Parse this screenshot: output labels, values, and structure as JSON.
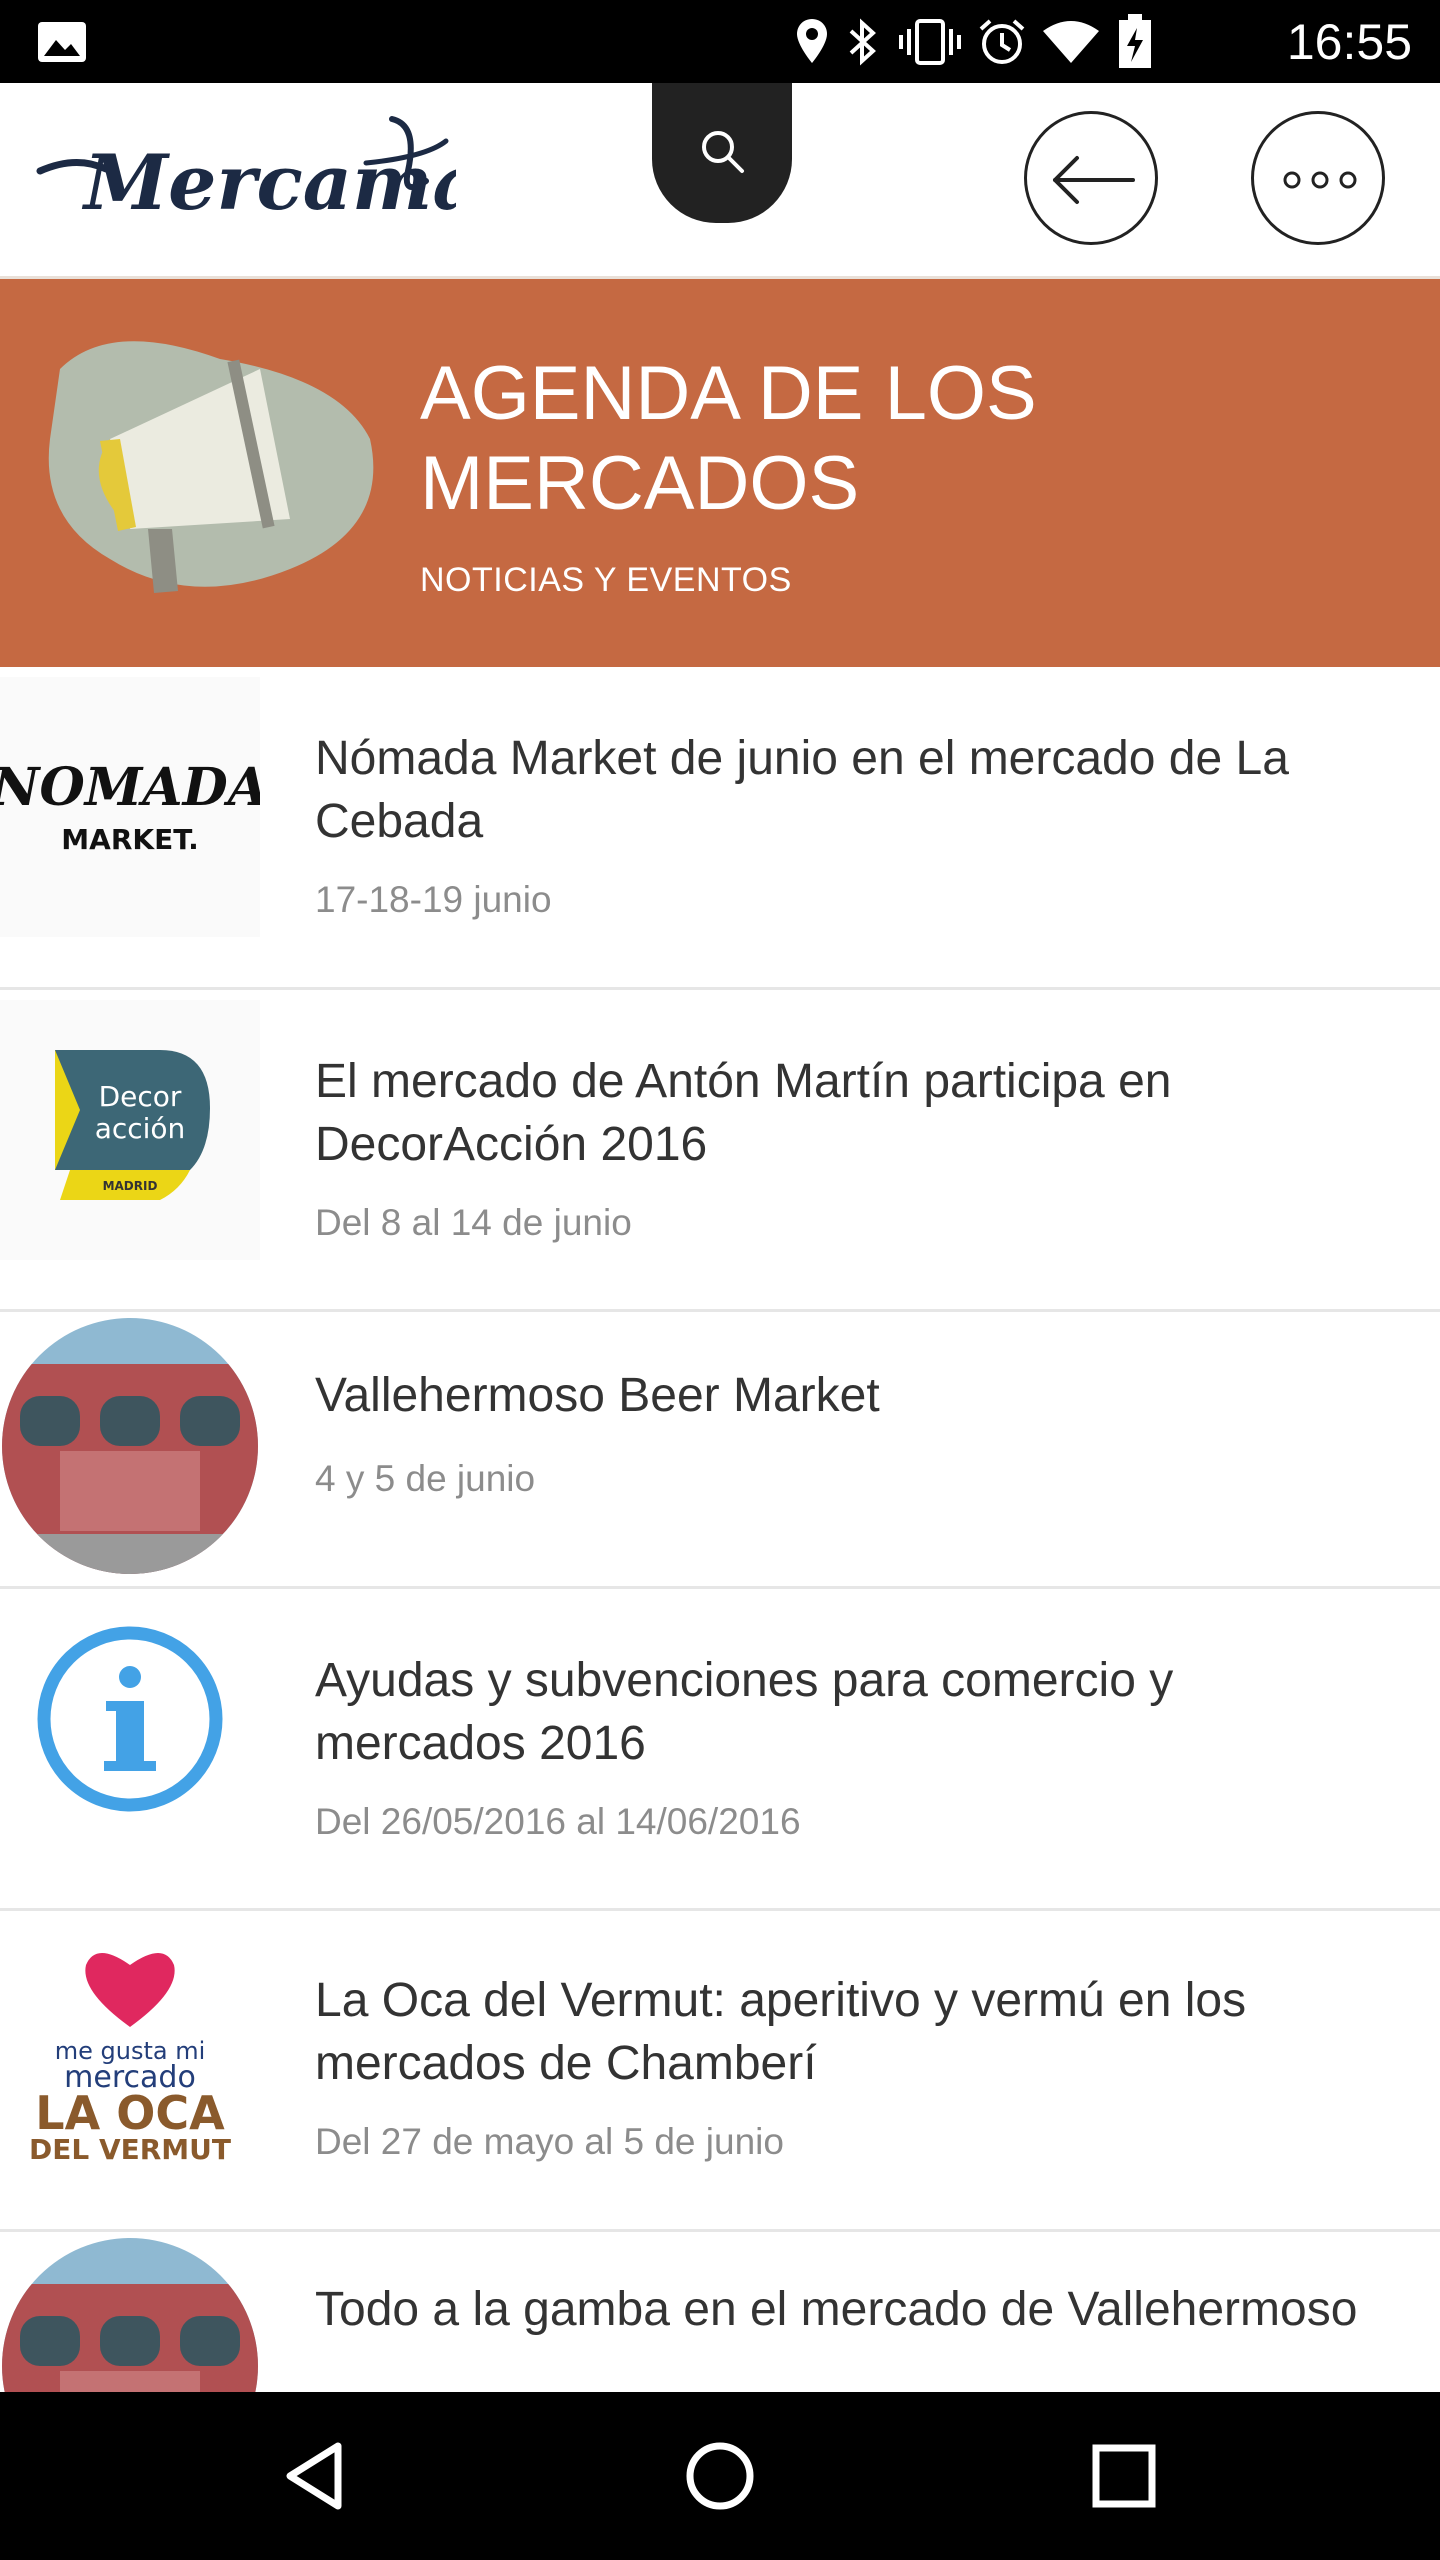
{
  "status_bar": {
    "time": "16:55"
  },
  "header": {
    "logo_text": "Mercamad",
    "search_icon": "search-icon",
    "back_icon": "arrow-left-icon",
    "more_icon": "more-dots-icon"
  },
  "banner": {
    "title": "AGENDA DE LOS MERCADOS",
    "subtitle": "NOTICIAS Y EVENTOS",
    "icon": "megaphone-icon",
    "color": "#c56942"
  },
  "events": [
    {
      "title": "Nómada Market de junio en el mercado de La Cebada",
      "date": "17-18-19 junio",
      "thumb": "nomada-market-logo",
      "thumb_text": [
        "NOMADA",
        "MARKET."
      ]
    },
    {
      "title": "El mercado de Antón Martín participa en DecorAcción 2016",
      "date": "Del 8 al 14 de junio",
      "thumb": "decoraccion-logo",
      "thumb_text": [
        "Decor",
        "acción",
        "MADRID"
      ]
    },
    {
      "title": "Vallehermoso Beer Market",
      "date": "4 y 5 de junio",
      "thumb": "market-building-image"
    },
    {
      "title": "Ayudas y subvenciones para comercio y mercados 2016",
      "date": "Del 26/05/2016 al 14/06/2016",
      "thumb": "info-icon"
    },
    {
      "title": "La Oca del Vermut: aperitivo y vermú en los mercados de Chamberí",
      "date": "Del 27 de mayo al 5 de junio",
      "thumb": "la-oca-del-vermut-logo",
      "thumb_text": [
        "me gusta mi",
        "mercado",
        "LA OCA",
        "DEL VERMUT"
      ]
    },
    {
      "title": "Todo a la gamba en el mercado de Vallehermoso",
      "date": "",
      "thumb": "market-building-image"
    }
  ],
  "nav_bar": {
    "back": "nav-back-icon",
    "home": "nav-home-icon",
    "recents": "nav-recents-icon"
  }
}
